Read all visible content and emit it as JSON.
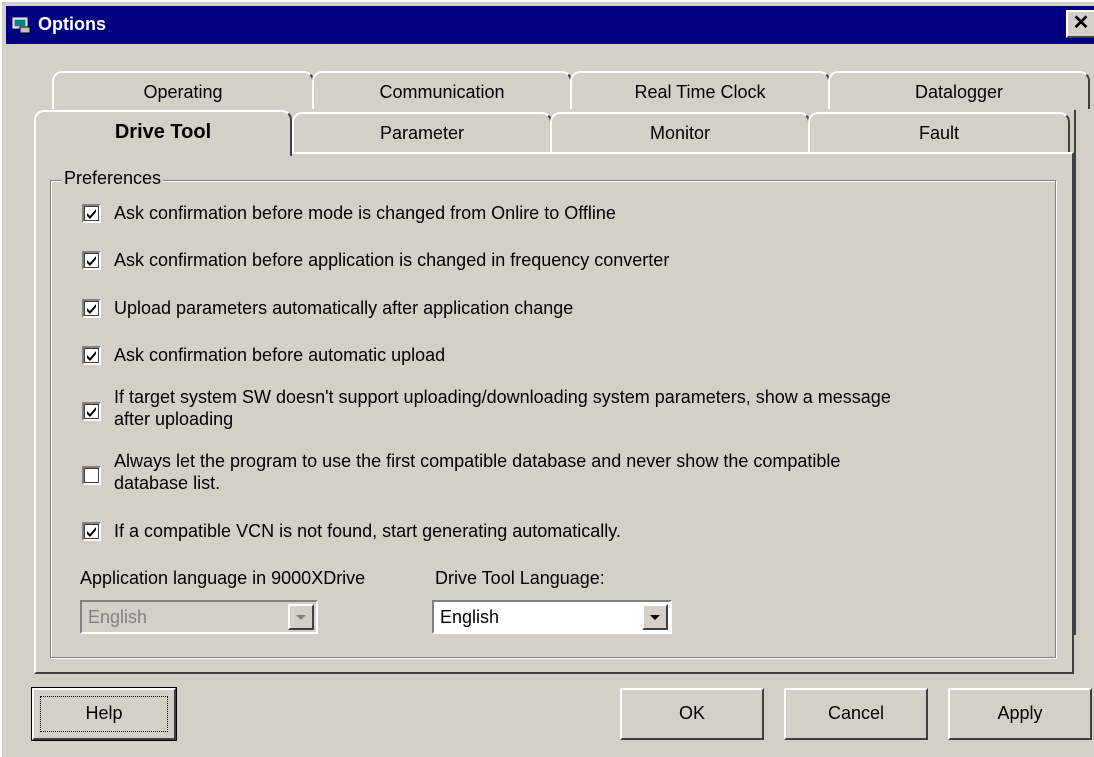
{
  "window": {
    "title": "Options",
    "close_glyph": "✕"
  },
  "tabs": {
    "back_row": [
      "Operating",
      "Communication",
      "Real Time Clock",
      "Datalogger"
    ],
    "front_row": [
      "Drive Tool",
      "Parameter",
      "Monitor",
      "Fault"
    ],
    "active": "Drive Tool"
  },
  "preferences": {
    "group_label": "Preferences",
    "options": [
      {
        "label": "Ask confirmation before mode is changed from Onlire to Offline",
        "checked": true
      },
      {
        "label": "Ask confirmation before application is changed in frequency converter",
        "checked": true
      },
      {
        "label": "Upload parameters automatically after application change",
        "checked": true
      },
      {
        "label": "Ask confirmation before automatic upload",
        "checked": true
      },
      {
        "label_line1": "If target system SW doesn't support uploading/downloading system parameters, show a message",
        "label_line2": "after uploading",
        "checked": true
      },
      {
        "label_line1": "Always let the program to use the first compatible database and never show the compatible",
        "label_line2": "database list.",
        "checked": false
      },
      {
        "label": "If a compatible VCN is not found, start generating automatically.",
        "checked": true
      }
    ]
  },
  "language": {
    "app_label": "Application language in 9000XDrive",
    "app_value": "English",
    "tool_label": "Drive Tool Language:",
    "tool_value": "English"
  },
  "buttons": {
    "help": "Help",
    "ok": "OK",
    "cancel": "Cancel",
    "apply": "Apply"
  },
  "colors": {
    "titlebar": "#000080",
    "face": "#d4d0c8",
    "disabled_text": "#808080"
  }
}
